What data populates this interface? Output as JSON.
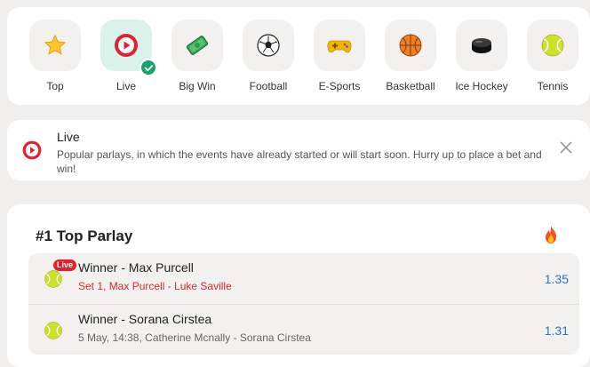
{
  "categories": [
    {
      "label": "Top",
      "icon": "star-icon"
    },
    {
      "label": "Live",
      "icon": "live-play-icon",
      "active": true
    },
    {
      "label": "Big Win",
      "icon": "money-icon"
    },
    {
      "label": "Football",
      "icon": "soccer-ball-icon"
    },
    {
      "label": "E-Sports",
      "icon": "gamepad-icon"
    },
    {
      "label": "Basketball",
      "icon": "basketball-icon"
    },
    {
      "label": "Ice Hockey",
      "icon": "hockey-puck-icon"
    },
    {
      "label": "Tennis",
      "icon": "tennis-ball-icon"
    }
  ],
  "info": {
    "title": "Live",
    "text": "Popular parlays, in which the events have already started or will start soon. Hurry up to place a bet and win!"
  },
  "parlay": {
    "title": "#1 Top Parlay",
    "events": [
      {
        "badge": "Live",
        "title": "Winner - Max Purcell",
        "subtitle": "Set 1, Max Purcell - Luke Saville",
        "odd": "1.35",
        "live": true
      },
      {
        "title": "Winner - Sorana Cirstea",
        "subtitle": "5 May, 14:38, Catherine Mcnally - Sorana Cirstea",
        "odd": "1.31",
        "live": false
      }
    ]
  },
  "colors": {
    "accent_green": "#16a36a",
    "live_red": "#e5202e",
    "odd_blue": "#2f74c0"
  }
}
